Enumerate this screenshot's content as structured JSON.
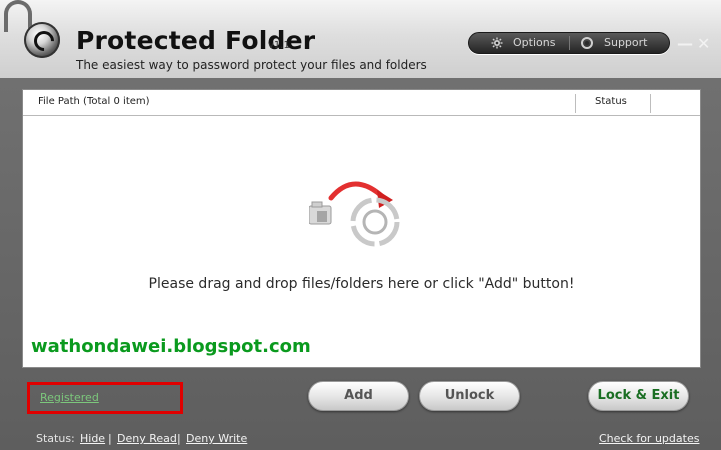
{
  "app": {
    "title": "Protected Folder",
    "version": "v1.1",
    "subtitle": "The easiest way to password protect your files and folders"
  },
  "top_controls": {
    "options_label": "Options",
    "support_label": "Support",
    "minimize_glyph": "—",
    "close_glyph": "✕"
  },
  "file_list": {
    "path_header": "File Path (Total 0 item)",
    "status_header": "Status",
    "drop_prompt": "Please drag and drop files/folders here or click \"Add\" button!"
  },
  "watermark": "wathondawei.blogspot.com",
  "registered": {
    "label": "Registered"
  },
  "buttons": {
    "add": "Add",
    "unlock": "Unlock",
    "lock_exit": "Lock & Exit"
  },
  "status": {
    "label": "Status:",
    "hide": "Hide",
    "deny_read": "Deny Read",
    "deny_write": "Deny Write",
    "separator": "|",
    "check_updates": "Check for updates"
  },
  "colors": {
    "accent_red": "#e00000",
    "watermark_green": "#0a9a1e",
    "action_green": "#1a6e23"
  }
}
